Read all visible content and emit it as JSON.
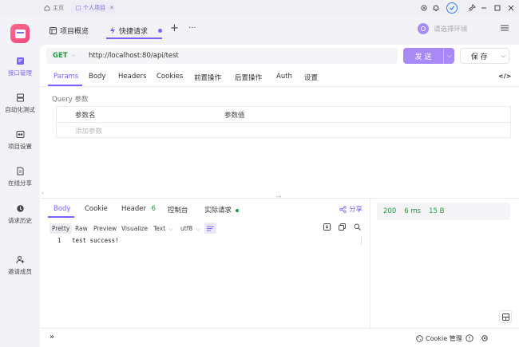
{
  "titlebar": {
    "home_tab": "主页",
    "project_tab": "个人项目"
  },
  "sidebar": {
    "items": [
      {
        "label": "接口管理",
        "icon": "api-icon"
      },
      {
        "label": "自动化测试",
        "icon": "automation-icon"
      },
      {
        "label": "项目设置",
        "icon": "settings-icon"
      },
      {
        "label": "在线分享",
        "icon": "share-doc-icon"
      },
      {
        "label": "请求历史",
        "icon": "history-icon"
      },
      {
        "label": "邀请成员",
        "icon": "invite-icon"
      }
    ]
  },
  "topbar": {
    "overview_tab": "项目概览",
    "active_tab": "快捷请求",
    "add": "+",
    "more": "···",
    "env_placeholder": "请选择环境"
  },
  "request": {
    "method": "GET",
    "url": "http://localhost:80/api/test",
    "send_label": "发 送",
    "save_label": "保 存",
    "tabs": [
      "Params",
      "Body",
      "Headers",
      "Cookies",
      "前置操作",
      "后置操作",
      "Auth",
      "设置"
    ],
    "active_tab": "Params",
    "code_toggle": "</>",
    "query_label": "Query 参数",
    "param_name_header": "参数名",
    "param_value_header": "参数值",
    "add_param_placeholder": "添加参数"
  },
  "response": {
    "tabs": {
      "body": "Body",
      "cookie": "Cookie",
      "header": "Header",
      "header_count": "6",
      "console": "控制台",
      "actual": "实际请求"
    },
    "share": "分享",
    "formats": [
      "Pretty",
      "Raw",
      "Preview",
      "Visualize"
    ],
    "active_format": "Pretty",
    "text_mode": "Text",
    "encoding": "utf8",
    "line_number": "1",
    "body_text": "test success!",
    "status": "200",
    "time": "6 ms",
    "size": "15 B"
  },
  "footer": {
    "expand": "»",
    "cookie_mgmt": "Cookie 管理"
  },
  "colors": {
    "accent": "#7b61ff",
    "send_button": "#a989f5",
    "success": "#1a9d3a",
    "logo": "#e8497a"
  }
}
